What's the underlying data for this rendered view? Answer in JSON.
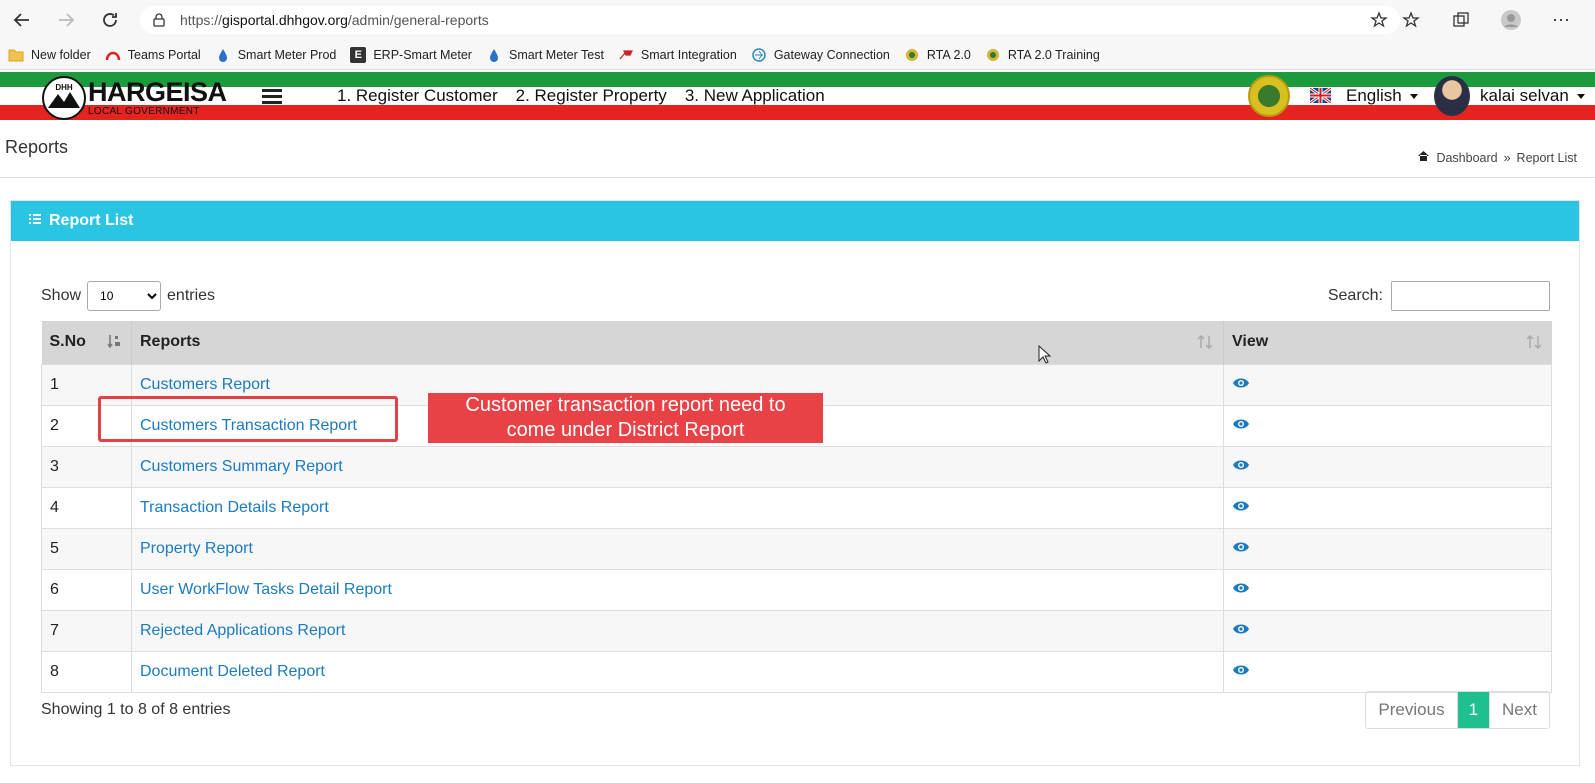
{
  "browser": {
    "url_prefix": "https://",
    "url_host": "gisportal.dhhgov.org",
    "url_path": "/admin/general-reports"
  },
  "bookmarks": [
    {
      "label": "New folder",
      "icon": "folder-icon"
    },
    {
      "label": "Teams Portal",
      "icon": "teams-icon"
    },
    {
      "label": "Smart Meter Prod",
      "icon": "drop-icon"
    },
    {
      "label": "ERP-Smart Meter",
      "icon": "e-icon"
    },
    {
      "label": "Smart Meter Test",
      "icon": "drop-icon"
    },
    {
      "label": "Smart Integration",
      "icon": "hammer-icon"
    },
    {
      "label": "Gateway Connection",
      "icon": "gateway-icon"
    },
    {
      "label": "RTA 2.0",
      "icon": "emblem-icon"
    },
    {
      "label": "RTA 2.0 Training",
      "icon": "emblem-icon"
    }
  ],
  "header": {
    "logo_letters": "DHH",
    "logo_title": "HARGEISA",
    "logo_subtitle": "LOCAL GOVERNMENT",
    "menu": [
      "1. Register Customer",
      "2. Register Property",
      "3. New Application"
    ],
    "language": "English",
    "user": "kalai selvan"
  },
  "page": {
    "title": "Reports",
    "breadcrumb": [
      "Dashboard",
      "»",
      "Report List"
    ]
  },
  "box": {
    "title": "Report List",
    "show_label": "Show",
    "entries_label": "entries",
    "page_size": "10",
    "search_label": "Search:",
    "search_value": ""
  },
  "table": {
    "columns": [
      "S.No",
      "Reports",
      "View"
    ],
    "rows": [
      {
        "sno": "1",
        "report": "Customers Report"
      },
      {
        "sno": "2",
        "report": "Customers Transaction Report"
      },
      {
        "sno": "3",
        "report": "Customers Summary Report"
      },
      {
        "sno": "4",
        "report": "Transaction Details Report"
      },
      {
        "sno": "5",
        "report": "Property Report"
      },
      {
        "sno": "6",
        "report": "User WorkFlow Tasks Detail Report"
      },
      {
        "sno": "7",
        "report": "Rejected Applications Report"
      },
      {
        "sno": "8",
        "report": "Document Deleted Report"
      }
    ]
  },
  "footer": {
    "info": "Showing 1 to 8 of 8 entries",
    "previous": "Previous",
    "current_page": "1",
    "next": "Next"
  },
  "annotation": {
    "line1": "Customer transaction report need to",
    "line2": "come under District Report"
  },
  "colors": {
    "accent": "#29c5e2",
    "link": "#1a7bbf",
    "active_page": "#1fbf8f",
    "annotation": "#e84146",
    "header_green": "#1e9a3e",
    "header_red": "#e52420"
  }
}
